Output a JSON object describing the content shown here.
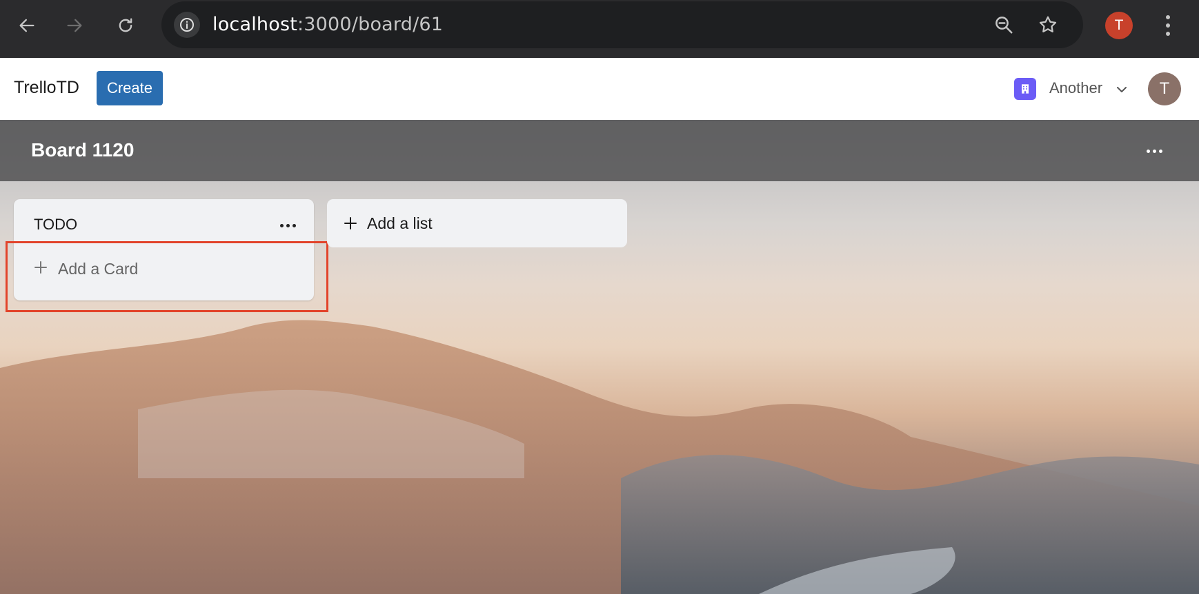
{
  "browser": {
    "url_host": "localhost",
    "url_path": ":3000/board/61",
    "profile_initial": "T"
  },
  "header": {
    "brand": "TrelloTD",
    "create_label": "Create",
    "workspace_name": "Another",
    "avatar_initial": "T"
  },
  "board": {
    "title": "Board 1120",
    "lists": [
      {
        "title": "TODO",
        "add_card_label": "Add a Card"
      }
    ],
    "add_list_label": "Add a list"
  },
  "colors": {
    "create_button": "#2a6db0",
    "highlight_border": "#e2432a",
    "workspace_icon": "#6b5cf6",
    "avatar": "#8a7168",
    "profile_chip": "#c8412b"
  }
}
